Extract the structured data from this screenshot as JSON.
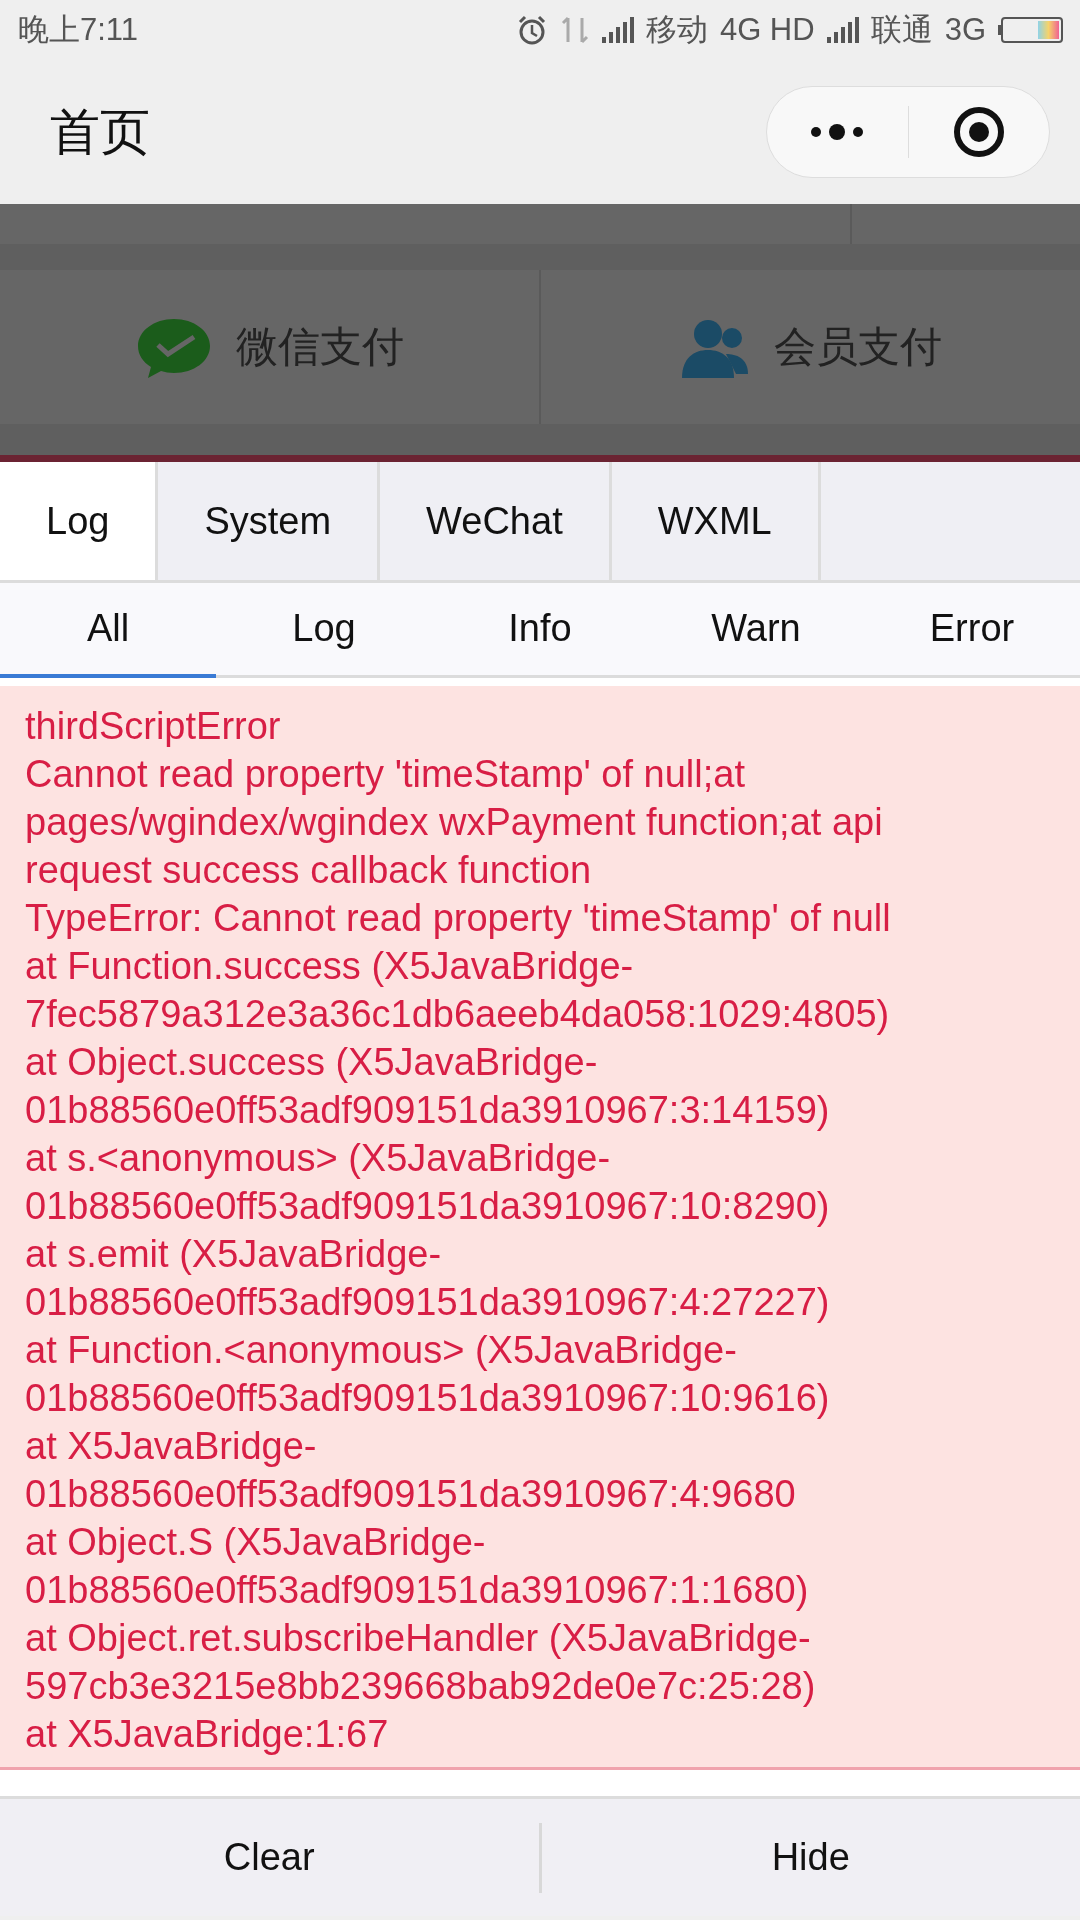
{
  "status_bar": {
    "time": "晚上7:11",
    "carriers": [
      {
        "name": "移动",
        "network": "4G HD"
      },
      {
        "name": "联通",
        "network": "3G"
      }
    ]
  },
  "nav_bar": {
    "title": "首页"
  },
  "payment_options": [
    {
      "kind": "wechat",
      "label": "微信支付"
    },
    {
      "kind": "member",
      "label": "会员支付"
    }
  ],
  "console": {
    "tabs": [
      {
        "label": "Log",
        "selected": true
      },
      {
        "label": "System",
        "selected": false
      },
      {
        "label": "WeChat",
        "selected": false
      },
      {
        "label": "WXML",
        "selected": false
      }
    ],
    "filters": [
      {
        "label": "All",
        "selected": true
      },
      {
        "label": "Log",
        "selected": false
      },
      {
        "label": "Info",
        "selected": false
      },
      {
        "label": "Warn",
        "selected": false
      },
      {
        "label": "Error",
        "selected": false
      }
    ],
    "entries": [
      {
        "kind": "error",
        "lines": [
          "thirdScriptError",
          "Cannot read property 'timeStamp' of null;at",
          "pages/wgindex/wgindex wxPayment function;at api",
          "request success callback function",
          "TypeError: Cannot read property 'timeStamp' of null",
          "at Function.success (X5JavaBridge-",
          "7fec5879a312e3a36c1db6aeeb4da058:1029:4805)",
          "at Object.success (X5JavaBridge-",
          "01b88560e0ff53adf909151da3910967:3:14159)",
          "at s.<anonymous> (X5JavaBridge-",
          "01b88560e0ff53adf909151da3910967:10:8290)",
          "at s.emit (X5JavaBridge-",
          "01b88560e0ff53adf909151da3910967:4:27227)",
          "at Function.<anonymous> (X5JavaBridge-",
          "01b88560e0ff53adf909151da3910967:10:9616)",
          "at X5JavaBridge-",
          "01b88560e0ff53adf909151da3910967:4:9680",
          "at Object.S (X5JavaBridge-",
          "01b88560e0ff53adf909151da3910967:1:1680)",
          "at Object.ret.subscribeHandler (X5JavaBridge-",
          "597cb3e3215e8bb239668bab92de0e7c:25:28)",
          "at X5JavaBridge:1:67"
        ]
      }
    ],
    "buttons": [
      "Clear",
      "Hide"
    ]
  }
}
